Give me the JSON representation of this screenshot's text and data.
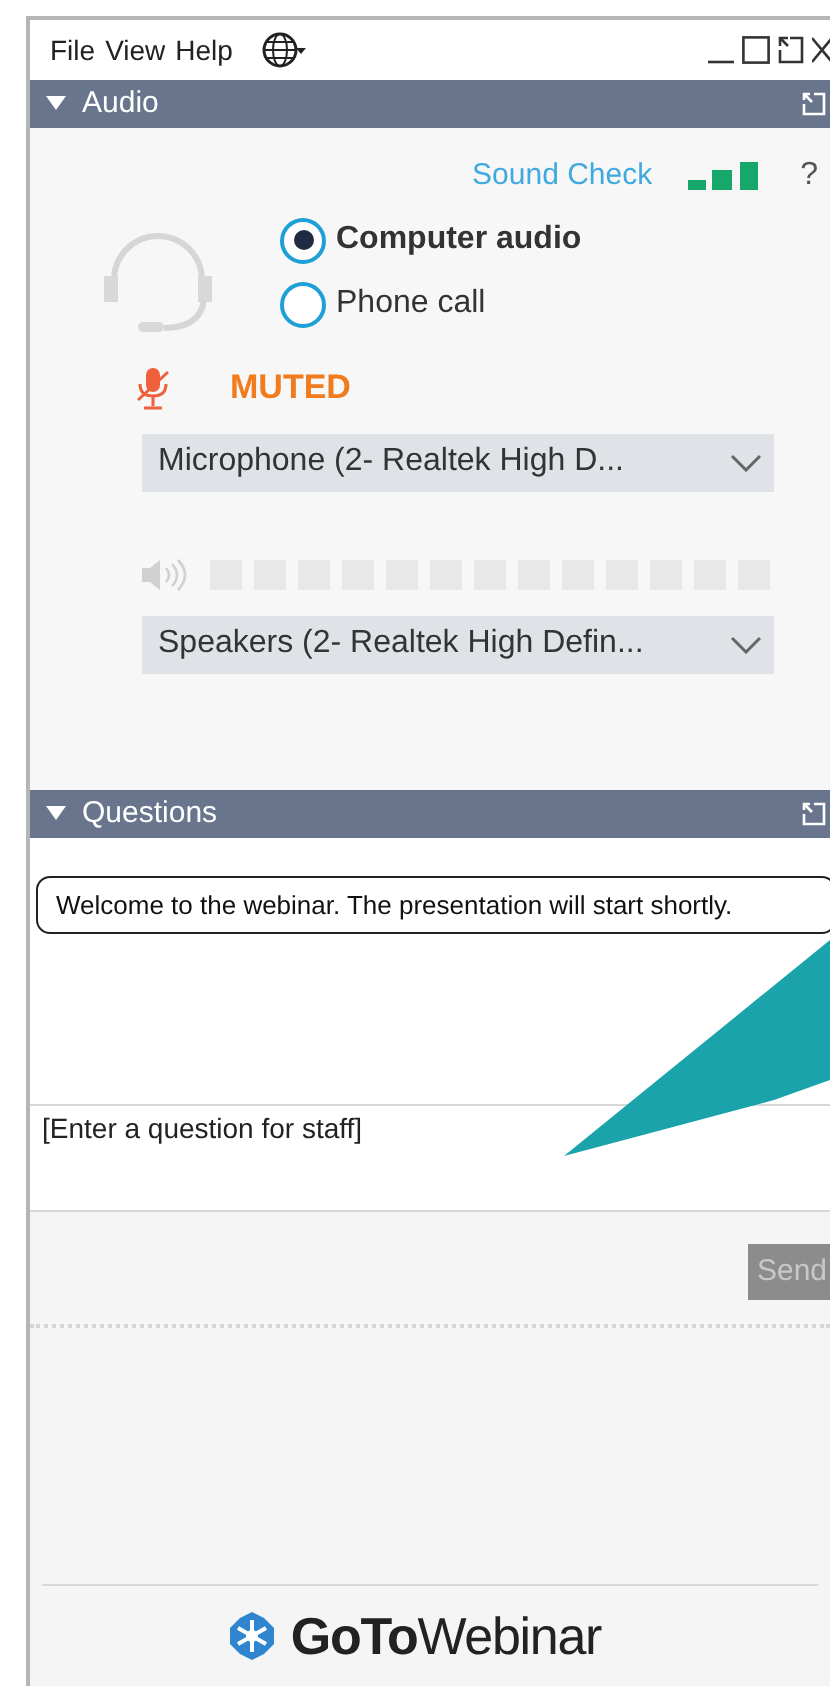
{
  "menu": [
    {
      "label": "File"
    },
    {
      "label": "View"
    },
    {
      "label": "Help"
    }
  ],
  "audio": {
    "title": "Audio",
    "expanded": true,
    "sound_check": "Sound Check",
    "help": "?",
    "options": [
      {
        "label": "Computer audio",
        "selected": true
      },
      {
        "label": "Phone call",
        "selected": false
      }
    ],
    "mute_status": "MUTED",
    "microphone": "Microphone (2- Realtek High D...",
    "speakers": "Speakers (2- Realtek High Defin..."
  },
  "questions": {
    "title": "Questions",
    "expanded": true,
    "placeholder": "[Enter a question for staff]",
    "send": "Send"
  },
  "callout": {
    "text": "Welcome to the webinar. The presentation will start shortly."
  },
  "logo": "**GoTo**Webinar"
}
